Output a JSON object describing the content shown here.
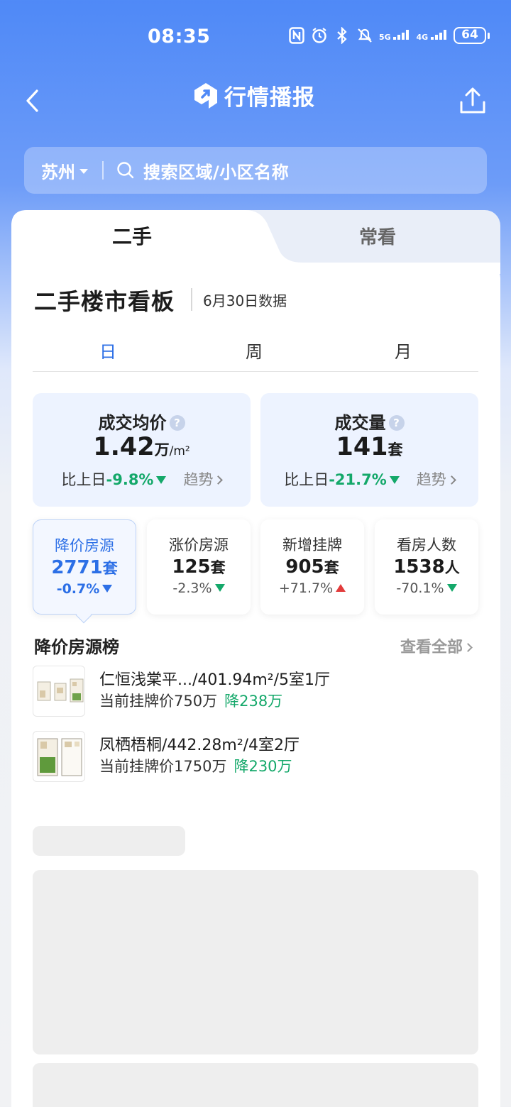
{
  "status_bar": {
    "time": "08:35",
    "battery": "64",
    "net1": "5G",
    "net2": "4G"
  },
  "header": {
    "title": "行情播报"
  },
  "search": {
    "city": "苏州",
    "placeholder": "搜索区域/小区名称"
  },
  "tabs": [
    {
      "label": "二手"
    },
    {
      "label": "常看"
    }
  ],
  "dashboard": {
    "title": "二手楼市看板",
    "date": "6月30日数据",
    "periods": [
      "日",
      "周",
      "月"
    ],
    "stats": [
      {
        "label": "成交均价",
        "value": "1.42",
        "unit": "万",
        "unit2": "/m²",
        "compare_prefix": "比上日",
        "change": "-9.8%",
        "trend": "趋势"
      },
      {
        "label": "成交量",
        "value": "141",
        "unit": "套",
        "unit2": "",
        "compare_prefix": "比上日",
        "change": "-21.7%",
        "trend": "趋势"
      }
    ],
    "metrics": [
      {
        "label": "降价房源",
        "value": "2771",
        "unit": "套",
        "change": "-0.7%"
      },
      {
        "label": "涨价房源",
        "value": "125",
        "unit": "套",
        "change": "-2.3%"
      },
      {
        "label": "新增挂牌",
        "value": "905",
        "unit": "套",
        "change": "+71.7%"
      },
      {
        "label": "看房人数",
        "value": "1538",
        "unit": "人",
        "change": "-70.1%"
      }
    ]
  },
  "price_drop_list": {
    "title": "降价房源榜",
    "view_all": "查看全部",
    "items": [
      {
        "name": "仁恒浅棠平.../401.94m²/5室1厅",
        "price_label": "当前挂牌价750万",
        "drop": "降238万"
      },
      {
        "name": "凤栖梧桐/442.28m²/4室2厅",
        "price_label": "当前挂牌价1750万",
        "drop": "降230万"
      }
    ]
  },
  "colors": {
    "primary": "#2c6fe6",
    "down": "#14a86a",
    "up": "#e23c3c",
    "header_bg": "#4f89f7"
  }
}
